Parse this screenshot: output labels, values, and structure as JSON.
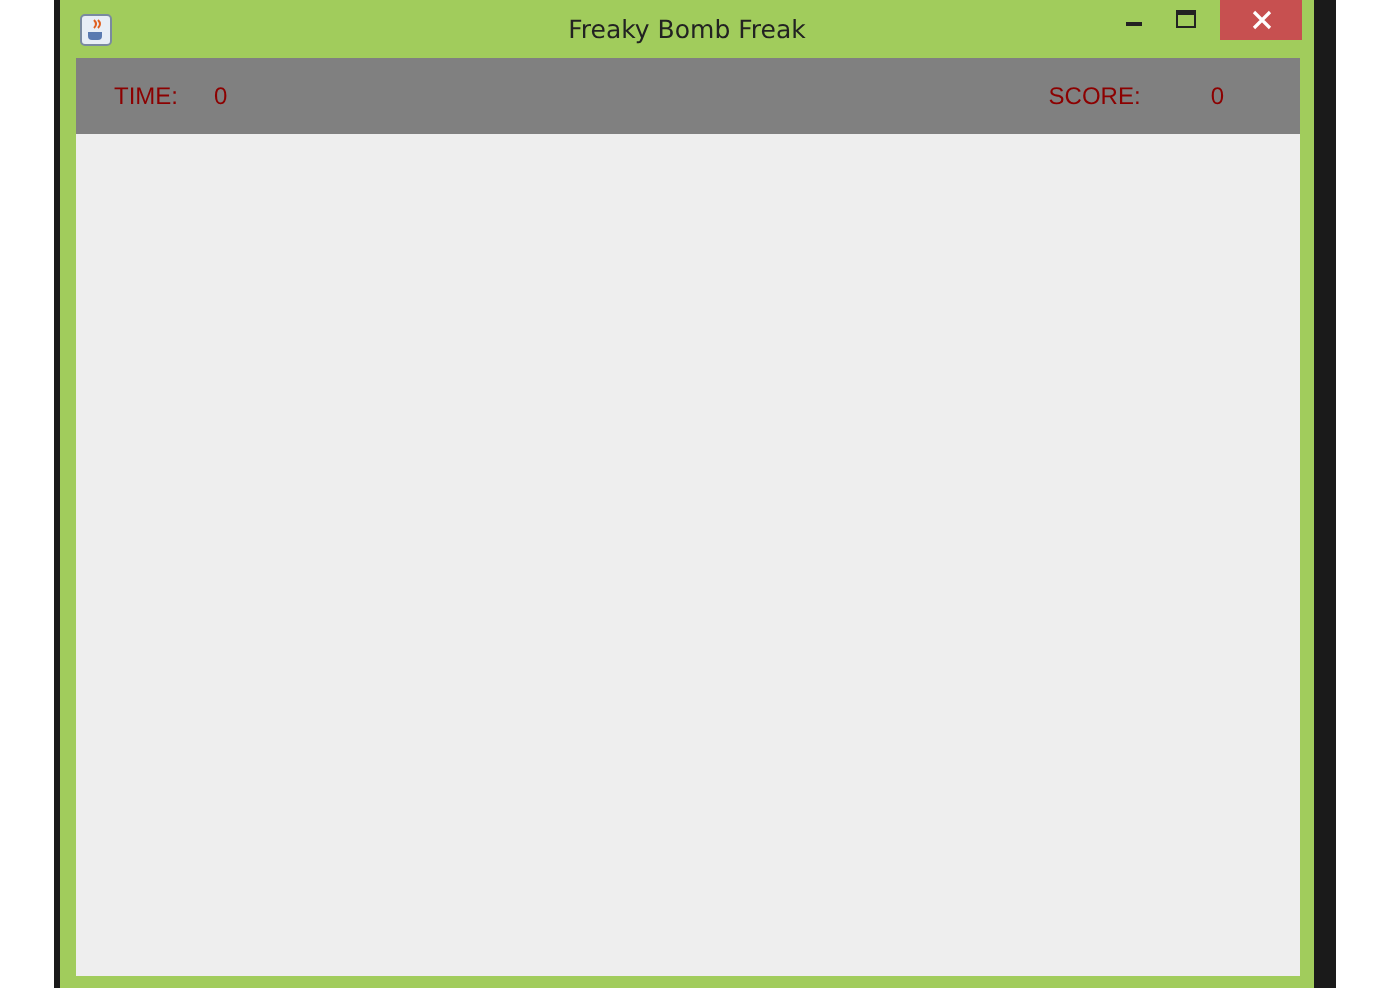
{
  "window": {
    "title": "Freaky Bomb Freak"
  },
  "header": {
    "time_label": "TIME:",
    "time_value": "0",
    "score_label": "SCORE:",
    "score_value": "0"
  }
}
